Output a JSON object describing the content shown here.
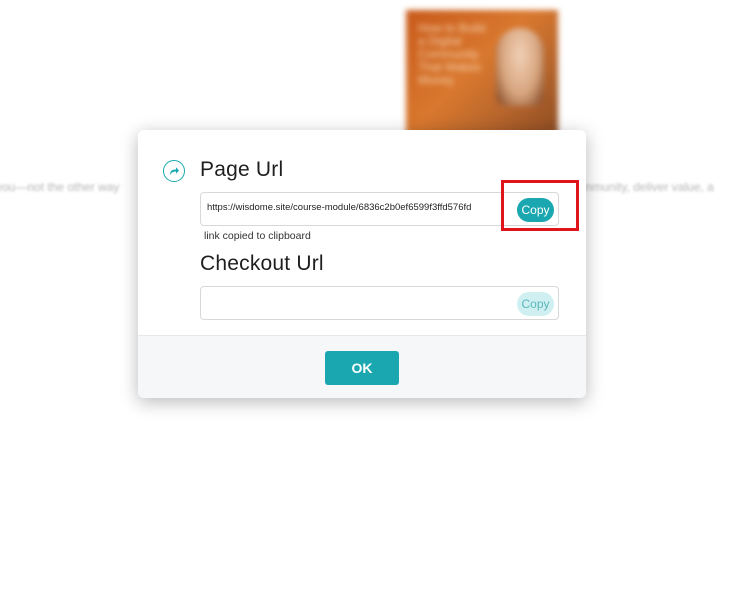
{
  "background": {
    "thumbnail_text": "How to Build a Digital Community That Makes Money",
    "text_left": "you—not the other way",
    "text_right": "mmunity, deliver value, a"
  },
  "modal": {
    "page_url": {
      "title": "Page Url",
      "value": "https://wisdome.site/course-module/6836c2b0ef6599f3ffd576fd",
      "copy_label": "Copy",
      "status": "link copied to clipboard"
    },
    "checkout_url": {
      "title": "Checkout Url",
      "value": "",
      "copy_label": "Copy"
    },
    "ok_label": "OK"
  },
  "colors": {
    "accent": "#1aa7b0",
    "highlight": "#e0141c"
  },
  "icons": {
    "share": "share-icon"
  }
}
